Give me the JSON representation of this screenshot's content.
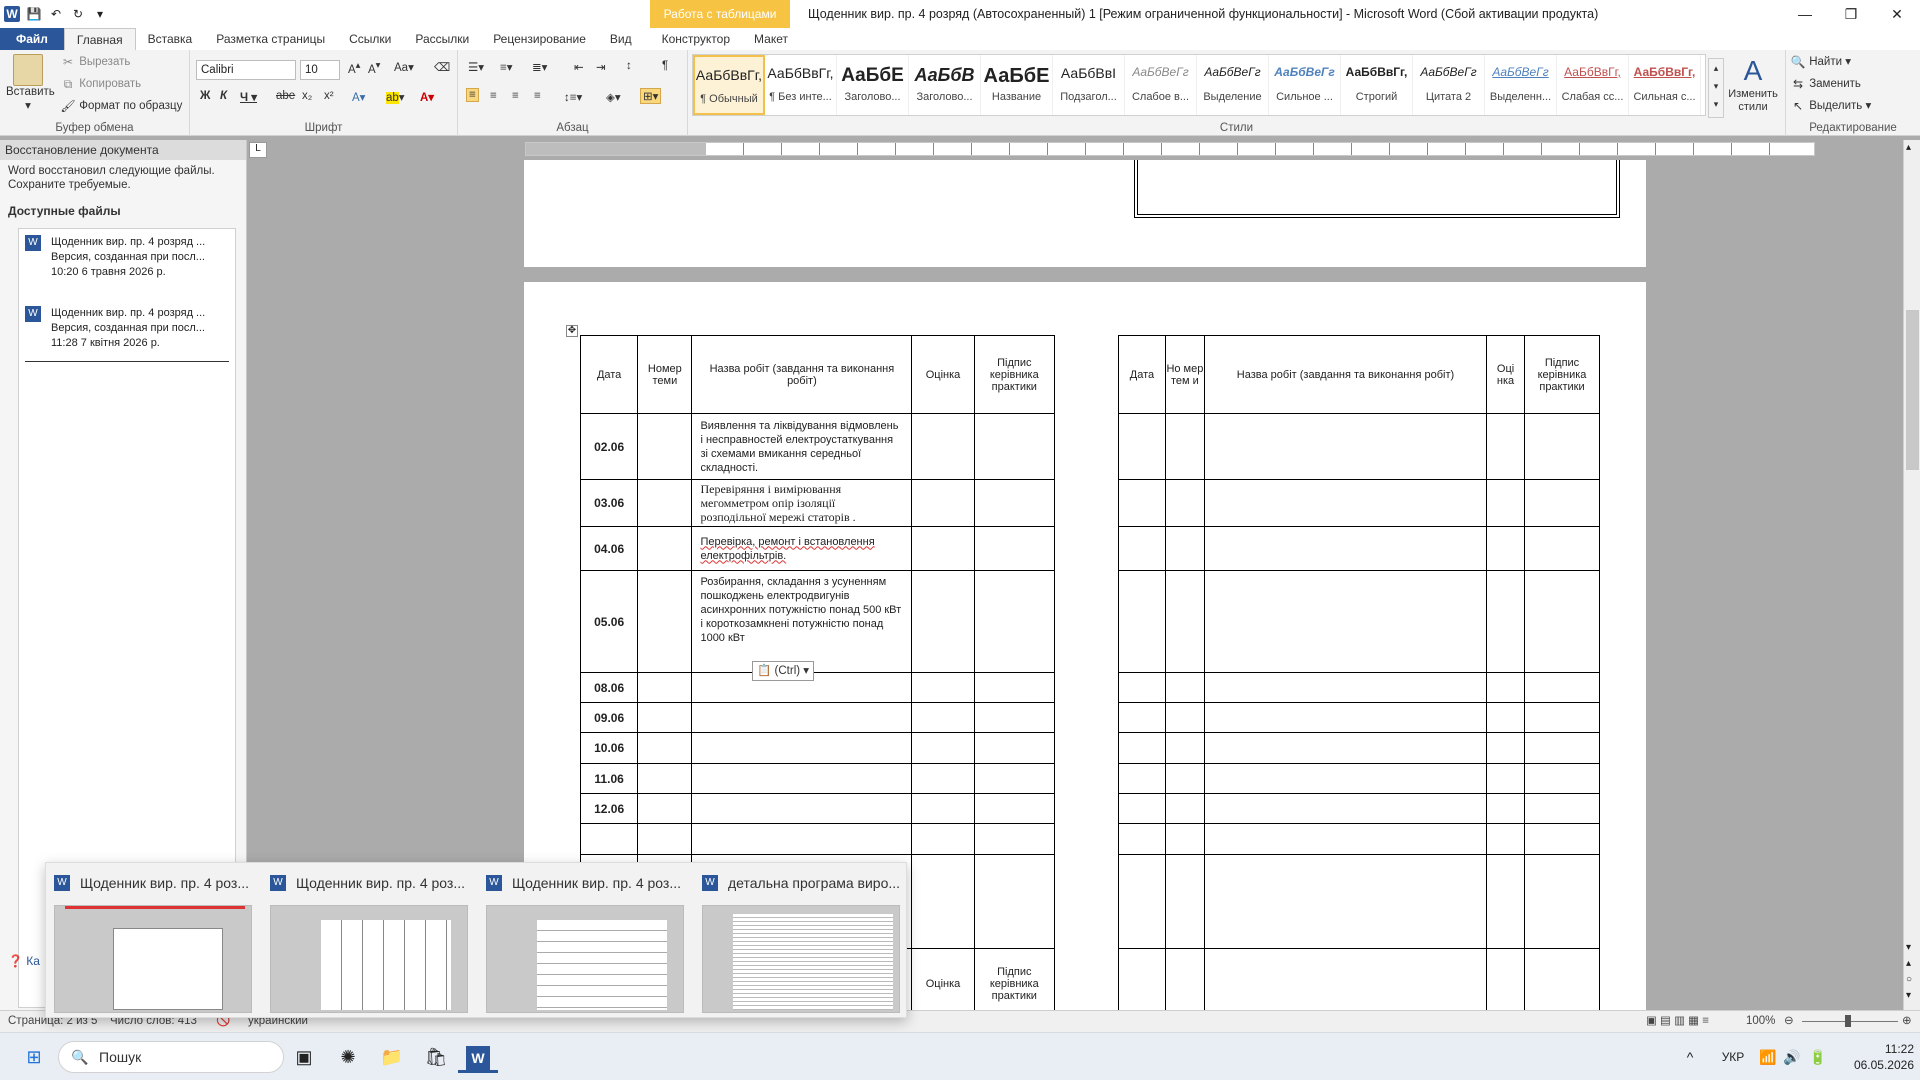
{
  "titlebar": {
    "context_tab": "Работа с таблицами",
    "title": "Щоденник вир. пр. 4 розряд (Автосохраненный) 1 [Режим ограниченной функциональности] - Microsoft Word (Сбой активации продукта)"
  },
  "tabs": [
    "Файл",
    "Главная",
    "Вставка",
    "Разметка страницы",
    "Ссылки",
    "Рассылки",
    "Рецензирование",
    "Вид",
    "Конструктор",
    "Макет"
  ],
  "clipboard": {
    "paste": "Вставить",
    "cut": "Вырезать",
    "copy": "Копировать",
    "format_painter": "Формат по образцу",
    "label": "Буфер обмена"
  },
  "font": {
    "name": "Calibri",
    "size": "10",
    "label": "Шрифт"
  },
  "paragraph": {
    "label": "Абзац"
  },
  "styles": {
    "label": "Стили",
    "items": [
      {
        "preview": "АаБбВвГг,",
        "name": "¶ Обычный"
      },
      {
        "preview": "АаБбВвГг,",
        "name": "¶ Без инте..."
      },
      {
        "preview": "АаБбЕ",
        "name": "Заголово..."
      },
      {
        "preview": "АаБбВ",
        "name": "Заголово..."
      },
      {
        "preview": "АаБбЕ",
        "name": "Название"
      },
      {
        "preview": "АаБбВвІ",
        "name": "Подзагол..."
      },
      {
        "preview": "АаБбВеГг",
        "name": "Слабое в..."
      },
      {
        "preview": "АаБбВеГг",
        "name": "Выделение"
      },
      {
        "preview": "АаБбВеГг",
        "name": "Сильное ..."
      },
      {
        "preview": "АаБбВвГг,",
        "name": "Строгий"
      },
      {
        "preview": "АаБбВеГг",
        "name": "Цитата 2"
      },
      {
        "preview": "АаБбВеГг",
        "name": "Выделенн..."
      },
      {
        "preview": "АаБбВвГг,",
        "name": "Слабая сс..."
      },
      {
        "preview": "АаБбВвГг,",
        "name": "Сильная с..."
      }
    ],
    "change": "Изменить стили"
  },
  "editing": {
    "find": "Найти",
    "replace": "Заменить",
    "select": "Выделить",
    "label": "Редактирование"
  },
  "recovery": {
    "title": "Восстановление документа",
    "text": "Word восстановил следующие файлы. Сохраните требуемые.",
    "available": "Доступные файлы",
    "files": [
      {
        "name": "Щоденник вир. пр. 4 розряд ...",
        "version": "Версия, созданная при посл...",
        "time": "10:20 6 травня 2026 р."
      },
      {
        "name": "Щоденник вир. пр. 4 розряд ...",
        "version": "Версия, созданная при посл...",
        "time": "11:28 7 квітня 2026 р."
      }
    ],
    "help": "Ка"
  },
  "table_left": {
    "headers": [
      "Дата",
      "Номер теми",
      "Назва робіт (завдання та виконання робіт)",
      "Оцінка",
      "Підпис керівника практики"
    ],
    "rows": [
      {
        "date": "02.06",
        "task": "Виявлення та ліквідування відмовлень і несправностей електроустаткування зі схемами вмикання середньої складності."
      },
      {
        "date": "03.06",
        "task": "Перевіряння і вимірювання мегомметром опір ізоляції розподільної мережі статорів ."
      },
      {
        "date": "04.06",
        "task": "Перевірка, ремонт і встановлення електрофільтрів."
      },
      {
        "date": "05.06",
        "task": "Розбирання, складання з усуненням пошкоджень електродвигунів асинхронних потужністю понад 500 кВт і короткозамкнені потужністю понад 1000 кВт"
      },
      {
        "date": "08.06",
        "task": ""
      },
      {
        "date": "09.06",
        "task": ""
      },
      {
        "date": "10.06",
        "task": ""
      },
      {
        "date": "11.06",
        "task": ""
      },
      {
        "date": "12.06",
        "task": ""
      }
    ]
  },
  "table_right": {
    "headers": [
      "Дата",
      "Но мер тем и",
      "Назва робіт (завдання та виконання робіт)",
      "Оці нка",
      "Підпис керівника практики"
    ]
  },
  "next_table": {
    "grade": "Оцінка",
    "sign": "Підпис керівника практики"
  },
  "paste_options": "(Ctrl)",
  "statusbar": {
    "page": "Страница: 2 из 5",
    "words": "Число слов: 413",
    "lang": "украинский",
    "zoom": "100%"
  },
  "thumbnails": [
    "Щоденник вир. пр. 4 роз...",
    "Щоденник вир. пр. 4 роз...",
    "Щоденник вир. пр. 4 роз...",
    "детальна програма виро..."
  ],
  "taskbar": {
    "search": "Пошук",
    "lang": "УКР",
    "time": "11:22",
    "date": "06.05.2026"
  }
}
